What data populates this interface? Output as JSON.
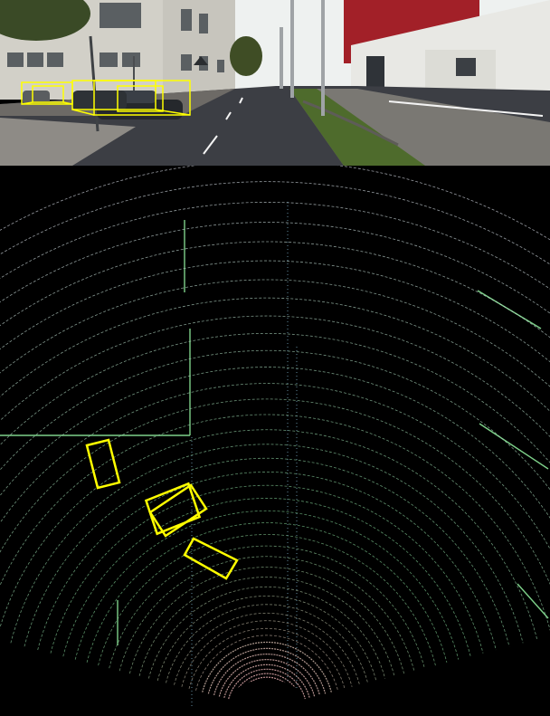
{
  "colors": {
    "sky": "#eef1f0",
    "road": "#3b3d42",
    "sidewalk": "#8a8886",
    "building_left": "#cfcfc8",
    "building_red": "#a3202a",
    "building_white": "#e6e6e2",
    "grass": "#4a6a2a",
    "tree": "#2e3a1e",
    "box": "#ffff00",
    "lidar_far": "#d8e0f0",
    "lidar_mid": "#7ed18a",
    "lidar_near": "#e79aa5"
  },
  "camera": {
    "icons": [
      "street-lamp-icon",
      "traffic-sign-icon",
      "car-icon"
    ]
  },
  "bev": {
    "icons": [
      "lidar-sensor-icon"
    ]
  }
}
